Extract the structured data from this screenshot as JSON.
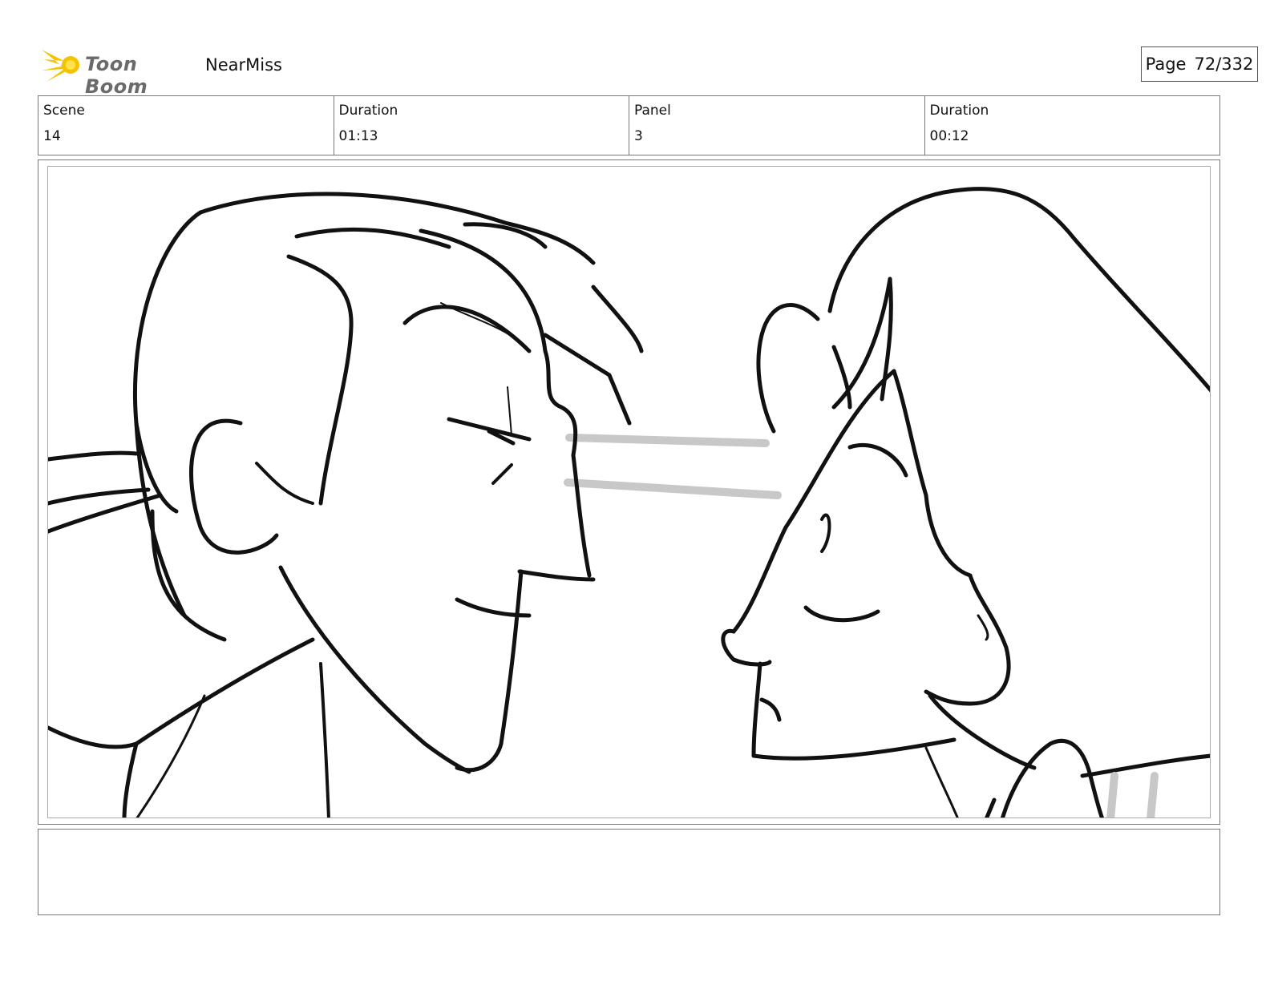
{
  "header": {
    "logo_text": "Toon Boom",
    "project_title": "NearMiss",
    "page_label": "Page",
    "page_number": "72/332"
  },
  "info": {
    "scene_label": "Scene",
    "scene_value": "14",
    "scene_duration_label": "Duration",
    "scene_duration_value": "01:13",
    "panel_label": "Panel",
    "panel_value": "3",
    "panel_duration_label": "Duration",
    "panel_duration_value": "00:12"
  },
  "colors": {
    "logo_sun": "#f5c400",
    "logo_text": "#6b6b6b",
    "sketch_line": "#111111",
    "eyeline": "#c8c8c8"
  },
  "icons": [
    "toon-boom-logo-icon"
  ],
  "notes": ""
}
